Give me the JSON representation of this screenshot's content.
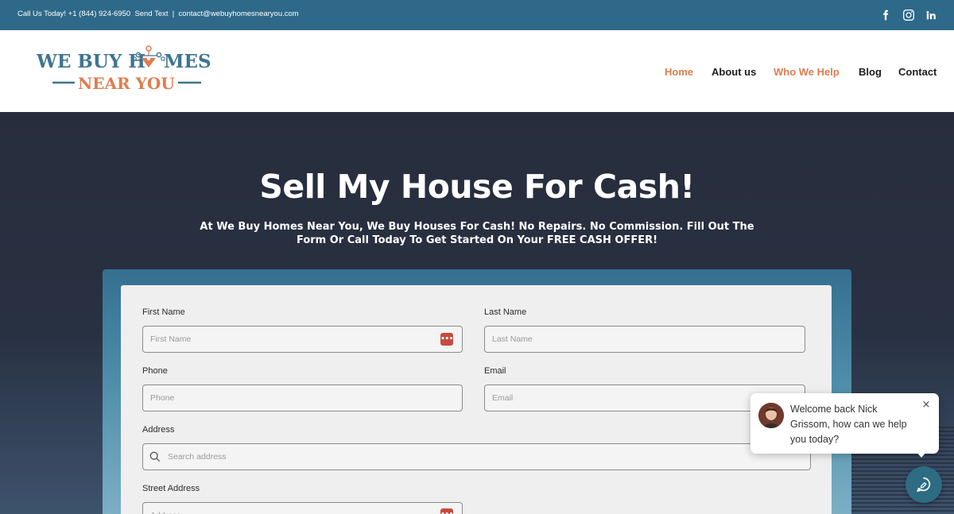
{
  "topbar": {
    "call_text": "Call Us Today! +1 (844) 924-6950",
    "send_text": "Send Text",
    "separator": "|",
    "email": "contact@webuyhomesnearyou.com",
    "social_icons": [
      "facebook-icon",
      "instagram-icon",
      "linkedin-icon"
    ]
  },
  "logo": {
    "line1_part1": "WE BUY H",
    "line1_part2": "MES",
    "line2": "NEAR YOU"
  },
  "nav": {
    "items": [
      {
        "label": "Home",
        "active": true
      },
      {
        "label": "About us",
        "active": false
      },
      {
        "label": "Who We Help",
        "active": true
      },
      {
        "label": "Blog",
        "active": false
      },
      {
        "label": "Contact",
        "active": false
      }
    ]
  },
  "hero": {
    "title": "Sell My House For Cash!",
    "subtitle_line1": "At We Buy Homes Near You, We Buy Houses For Cash! No Repairs. No Commission. Fill Out The",
    "subtitle_line2": "Form Or Call Today To Get Started On Your FREE CASH OFFER!"
  },
  "form": {
    "first_name": {
      "label": "First Name",
      "placeholder": "First Name",
      "value": ""
    },
    "last_name": {
      "label": "Last Name",
      "placeholder": "Last Name",
      "value": ""
    },
    "phone": {
      "label": "Phone",
      "placeholder": "Phone",
      "value": ""
    },
    "email": {
      "label": "Email",
      "placeholder": "Email",
      "value": ""
    },
    "address": {
      "label": "Address",
      "placeholder": "Search address",
      "value": ""
    },
    "street_address": {
      "label": "Street Address",
      "placeholder": "Address",
      "value": ""
    }
  },
  "chat": {
    "message": "Welcome back Nick Grissom, how can we help you today?",
    "close_glyph": "×"
  },
  "colors": {
    "topbar": "#2f6989",
    "accent_orange": "#e07c4e",
    "logo_blue": "#3f7591",
    "hero_bg": "#272d3c",
    "chat_button": "#2e6c84"
  }
}
